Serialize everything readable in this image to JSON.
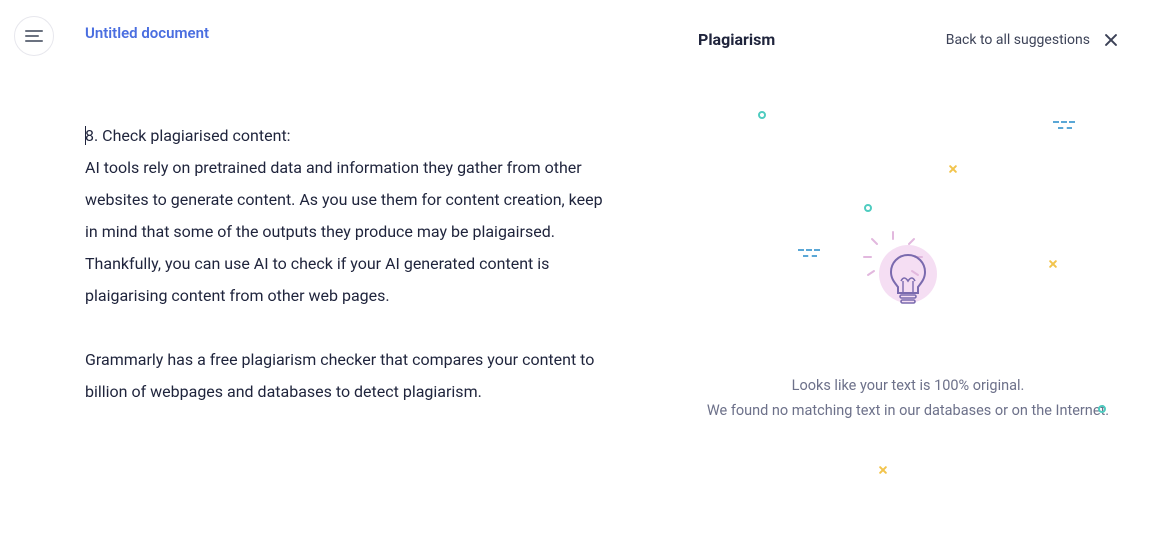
{
  "header": {
    "document_title": "Untitled document"
  },
  "editor": {
    "paragraph1": "8. Check plagiarised content:\nAI tools rely on pretrained data and information they gather from other websites to generate content. As you use them for content creation, keep in mind that some of the outputs they produce may be plaigairsed. Thankfully, you can use AI to check if your AI generated content is plaigarising content from other web pages.",
    "paragraph2": "Grammarly has a free plagiarism checker that compares your content to billion of webpages and databases to detect plagiarism."
  },
  "panel": {
    "title": "Plagiarism",
    "back_label": "Back to all suggestions",
    "result_line1": "Looks like your text is 100% original.",
    "result_line2": "We found no matching text in our databases or on the Internet."
  }
}
